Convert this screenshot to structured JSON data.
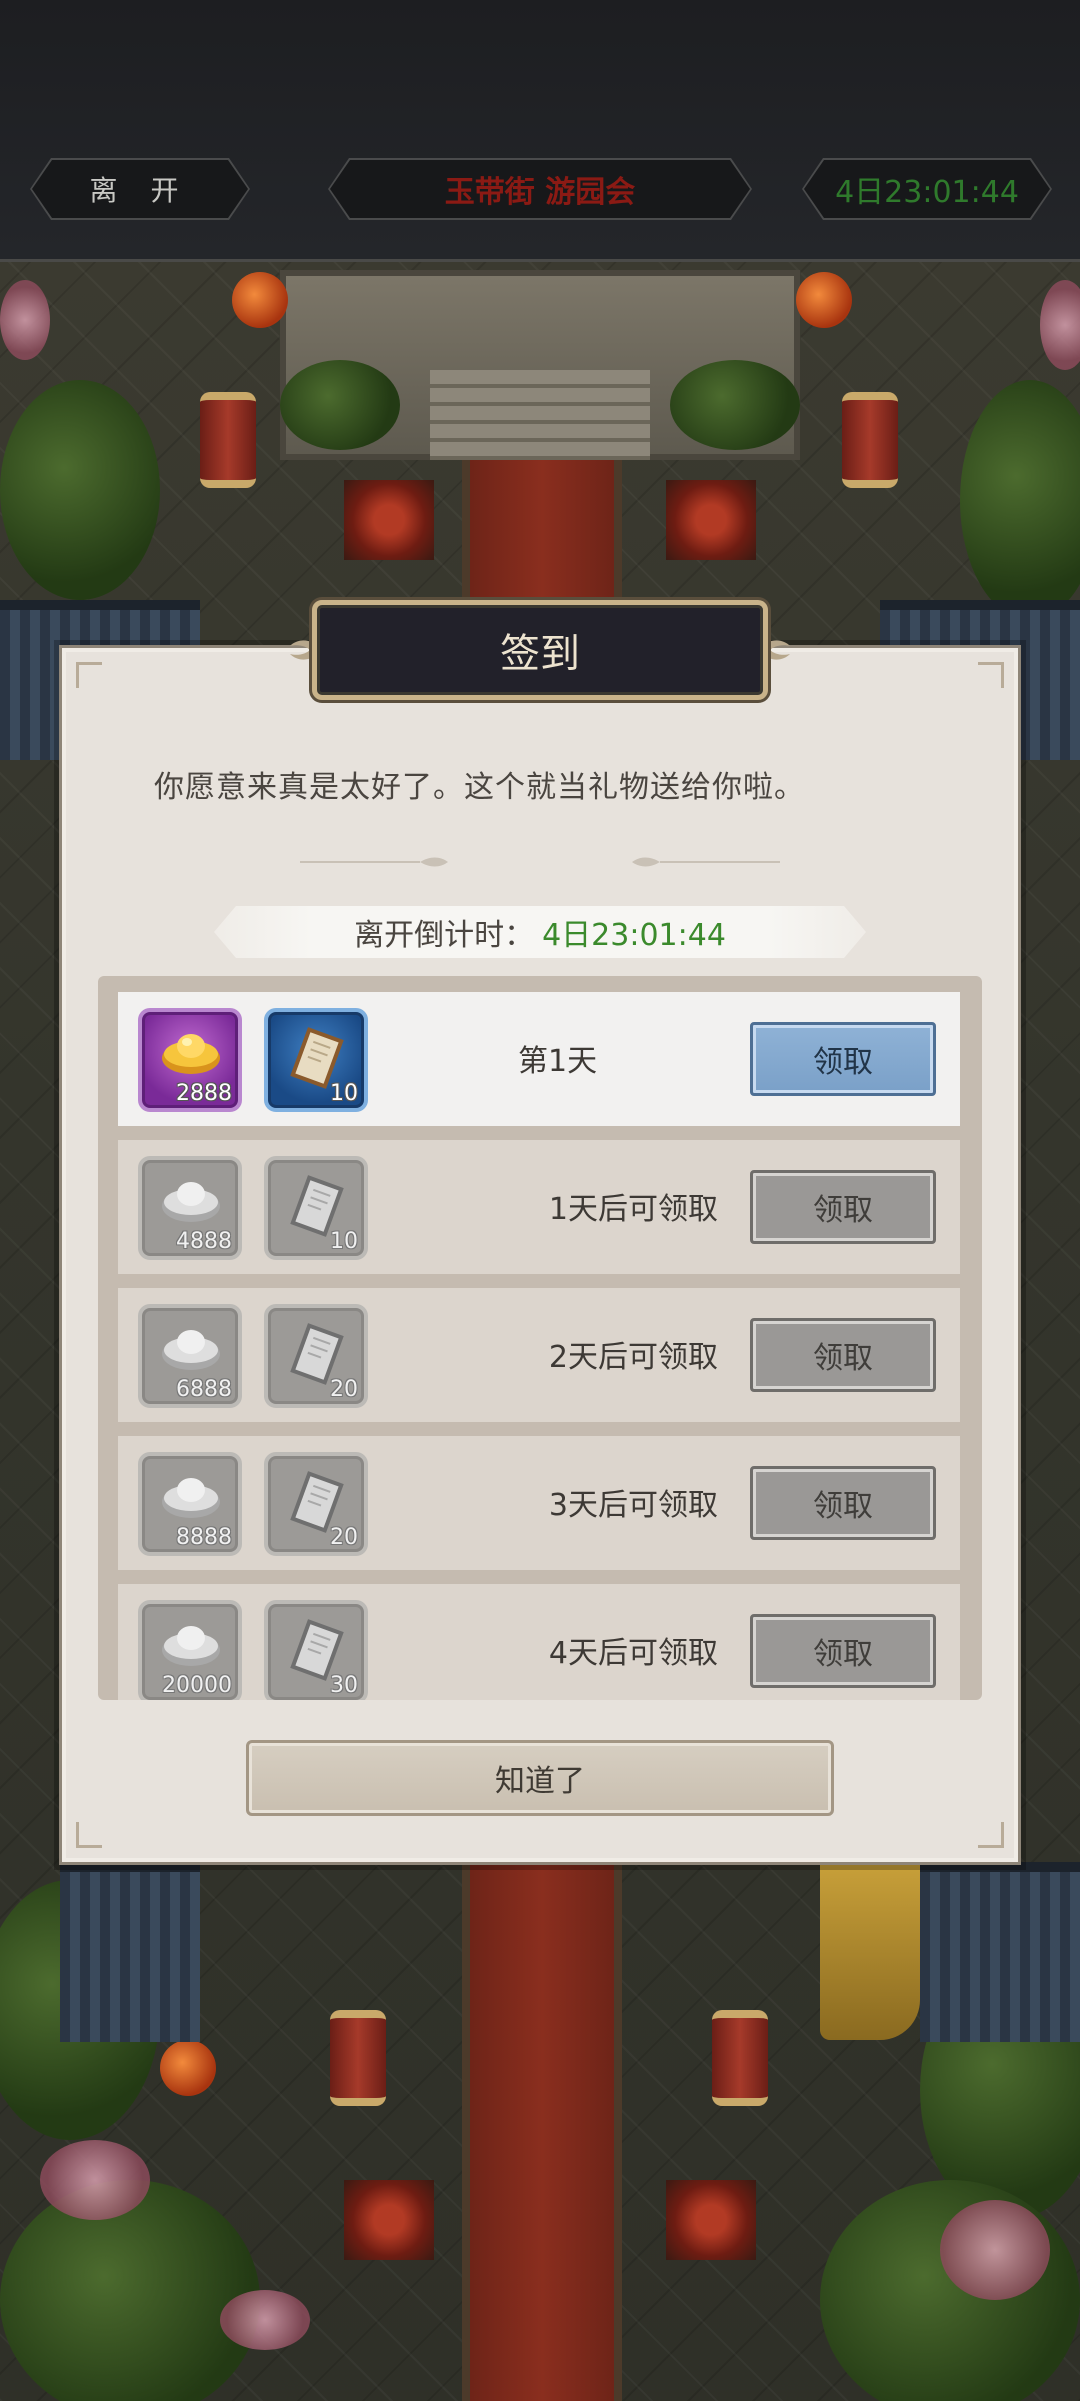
{
  "topbar": {
    "leave_label": "离 开",
    "event_title": "玉带街 游园会",
    "event_timer": "4日23:01:44"
  },
  "dialog": {
    "title": "签到",
    "greeting": "你愿意来真是太好了。这个就当礼物送给你啦。",
    "countdown_label": "离开倒计时：",
    "countdown_value": "4日23:01:44",
    "confirm_label": "知道了"
  },
  "rewards": [
    {
      "status": "第1天",
      "claim_label": "领取",
      "state": "available",
      "items": [
        {
          "icon": "gold-ingot-icon",
          "qty": "2888"
        },
        {
          "icon": "letter-icon",
          "qty": "10"
        }
      ]
    },
    {
      "status": "1天后可领取",
      "claim_label": "领取",
      "state": "locked",
      "items": [
        {
          "icon": "silver-ingot-icon",
          "qty": "4888"
        },
        {
          "icon": "letter-icon",
          "qty": "10"
        }
      ]
    },
    {
      "status": "2天后可领取",
      "claim_label": "领取",
      "state": "locked",
      "items": [
        {
          "icon": "silver-ingot-icon",
          "qty": "6888"
        },
        {
          "icon": "letter-icon",
          "qty": "20"
        }
      ]
    },
    {
      "status": "3天后可领取",
      "claim_label": "领取",
      "state": "locked",
      "items": [
        {
          "icon": "silver-ingot-icon",
          "qty": "8888"
        },
        {
          "icon": "letter-icon",
          "qty": "20"
        }
      ]
    },
    {
      "status": "4天后可领取",
      "claim_label": "领取",
      "state": "locked",
      "items": [
        {
          "icon": "silver-ingot-icon",
          "qty": "20000"
        },
        {
          "icon": "letter-icon",
          "qty": "30"
        }
      ]
    }
  ],
  "colors": {
    "timer_green": "#3b8a2c",
    "title_red": "#8b1a14",
    "active_claim_blue": "#7aa0c8"
  }
}
